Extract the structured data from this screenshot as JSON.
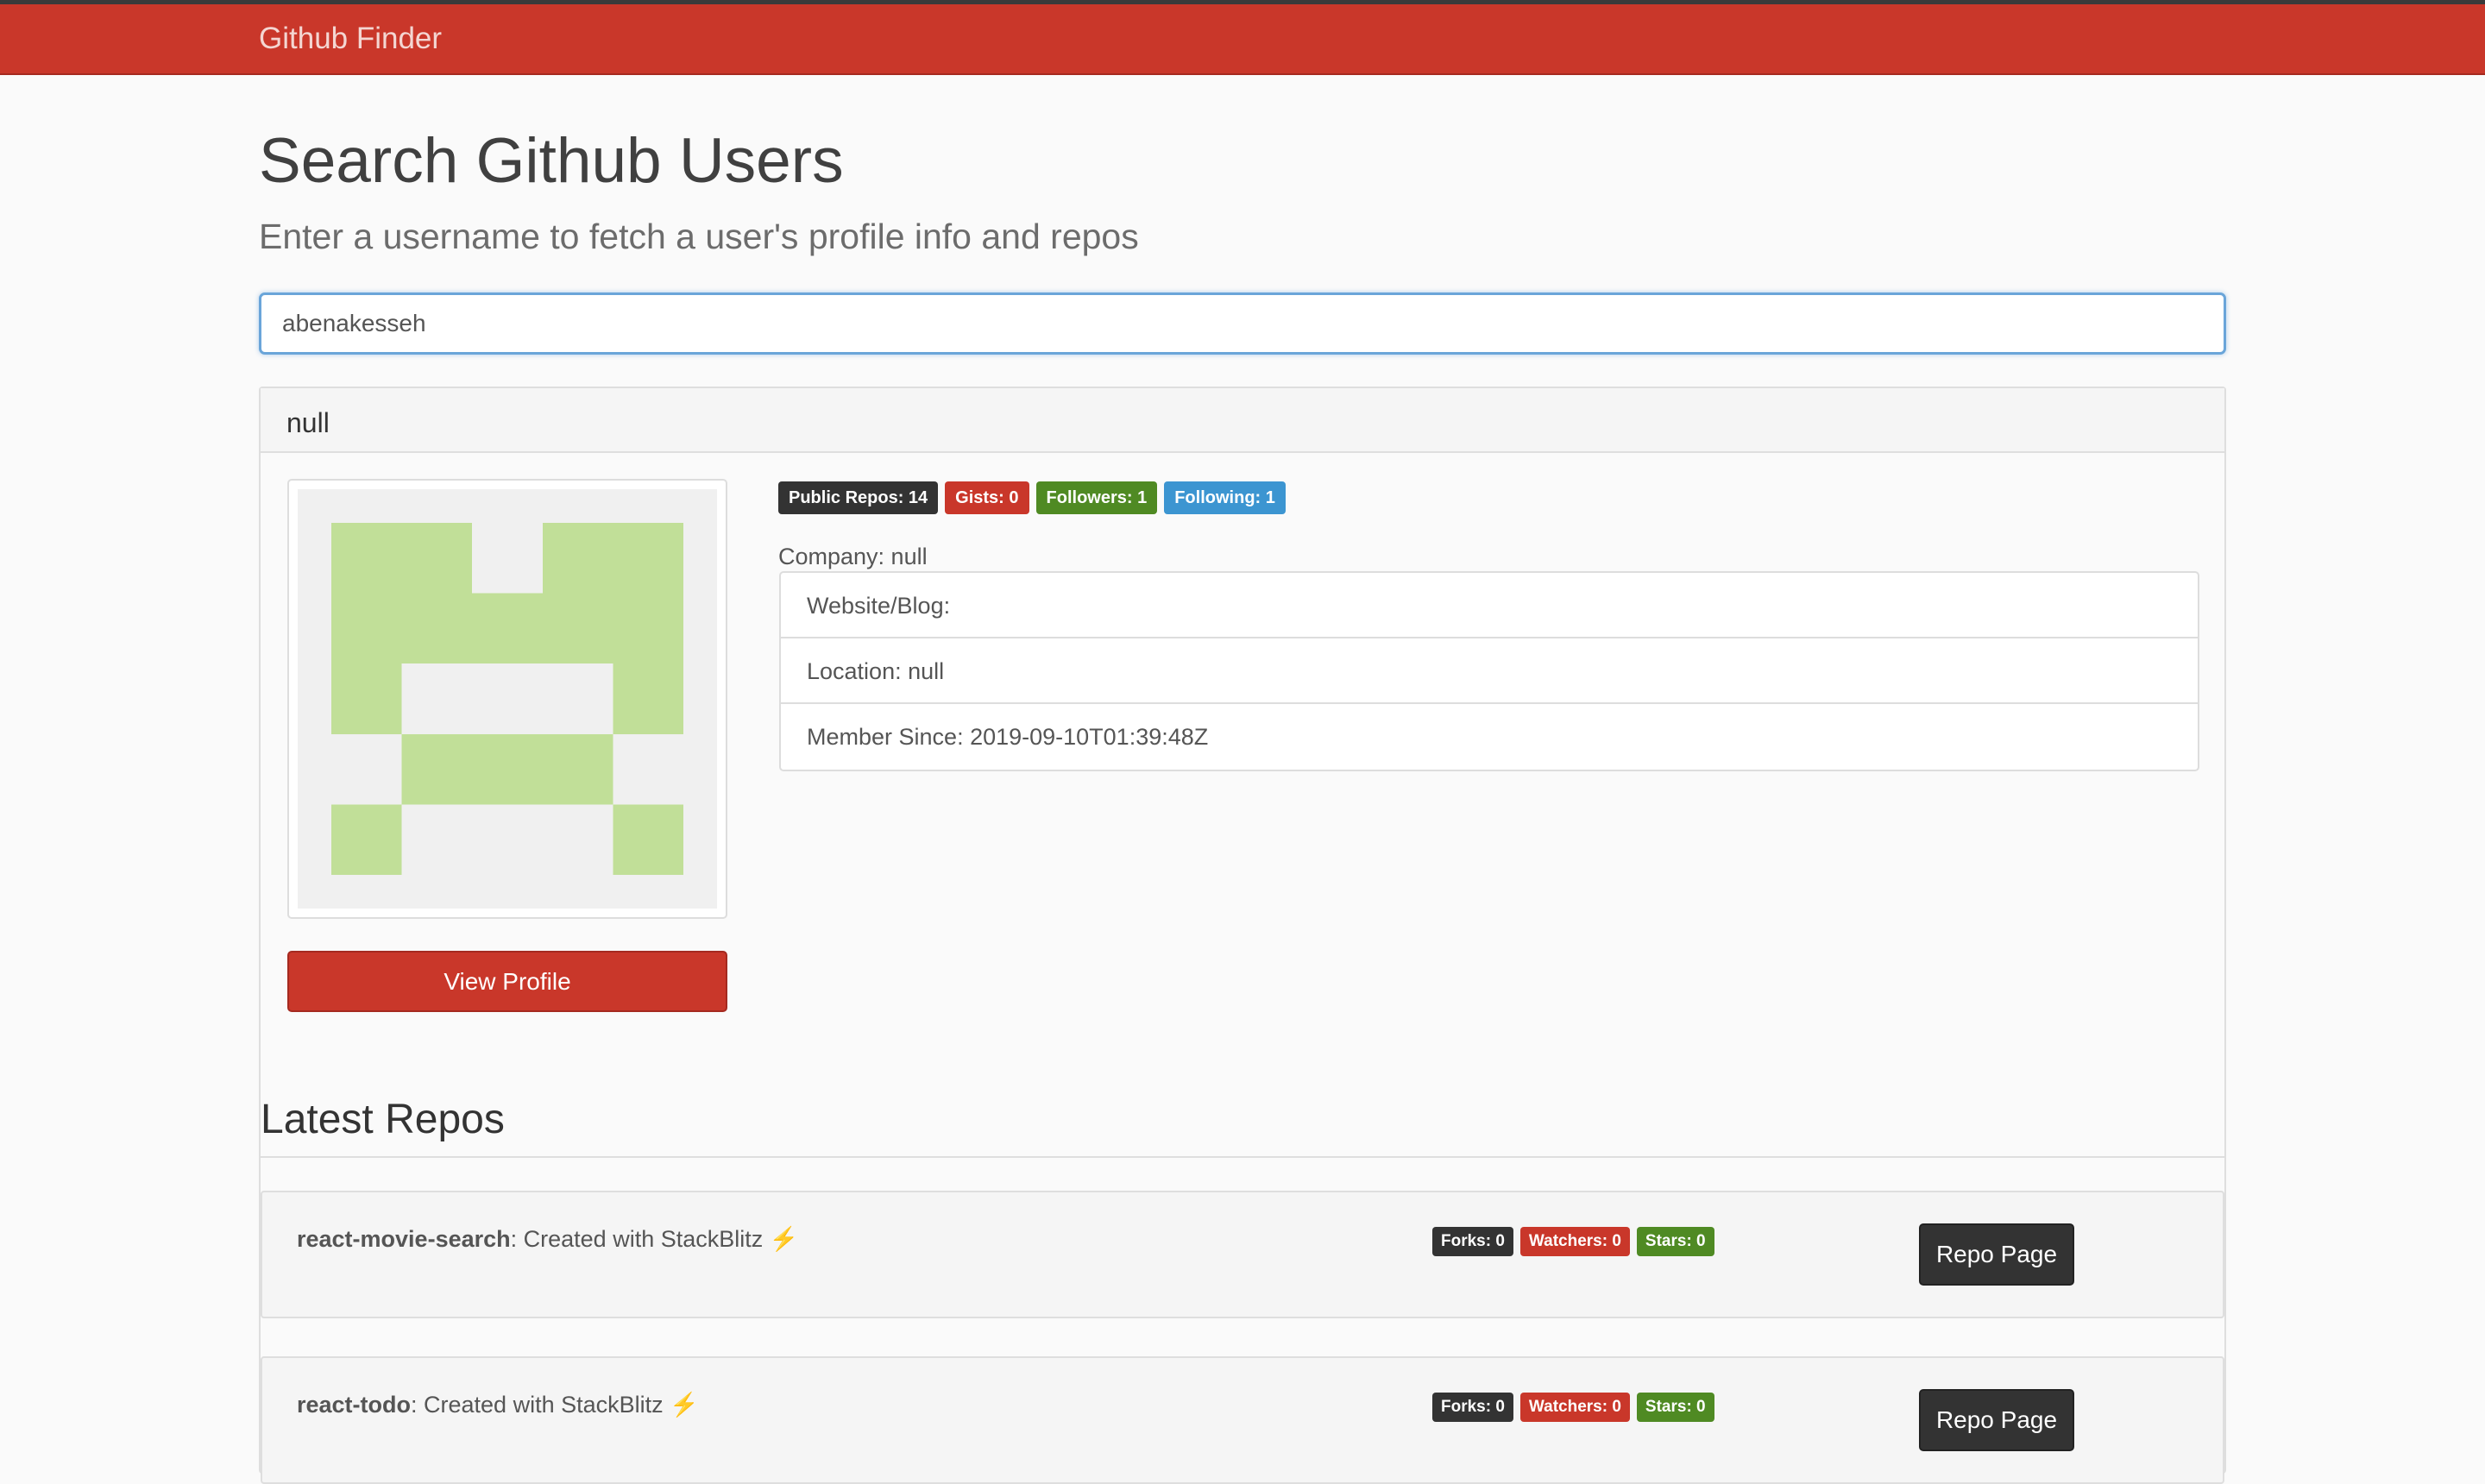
{
  "navbar": {
    "brand": "Github Finder"
  },
  "header": {
    "title": "Search Github Users",
    "subtitle": "Enter a username to fetch a user's profile info and repos"
  },
  "search": {
    "value": "abenakesseh"
  },
  "profile": {
    "name": "null",
    "view_profile_label": "View Profile",
    "badges": {
      "public_repos": "Public Repos: 14",
      "gists": "Gists: 0",
      "followers": "Followers: 1",
      "following": "Following: 1"
    },
    "company": "Company: null",
    "info": {
      "website": "Website/Blog:",
      "location": "Location: null",
      "member_since": "Member Since: 2019-09-10T01:39:48Z"
    }
  },
  "repos": {
    "heading": "Latest Repos",
    "items": [
      {
        "name": "react-movie-search",
        "description": ": Created with StackBlitz ",
        "bolt": "⚡",
        "forks": "Forks: 0",
        "watchers": "Watchers: 0",
        "stars": "Stars: 0",
        "button": "Repo Page"
      },
      {
        "name": "react-todo",
        "description": ": Created with StackBlitz ",
        "bolt": "⚡",
        "forks": "Forks: 0",
        "watchers": "Watchers: 0",
        "stars": "Stars: 0",
        "button": "Repo Page"
      }
    ]
  },
  "colors": {
    "brand_red": "#c9372a",
    "badge_dark": "#333333",
    "badge_green": "#4f8a23",
    "badge_blue": "#3c95d1",
    "identicon": "#c1df98"
  }
}
